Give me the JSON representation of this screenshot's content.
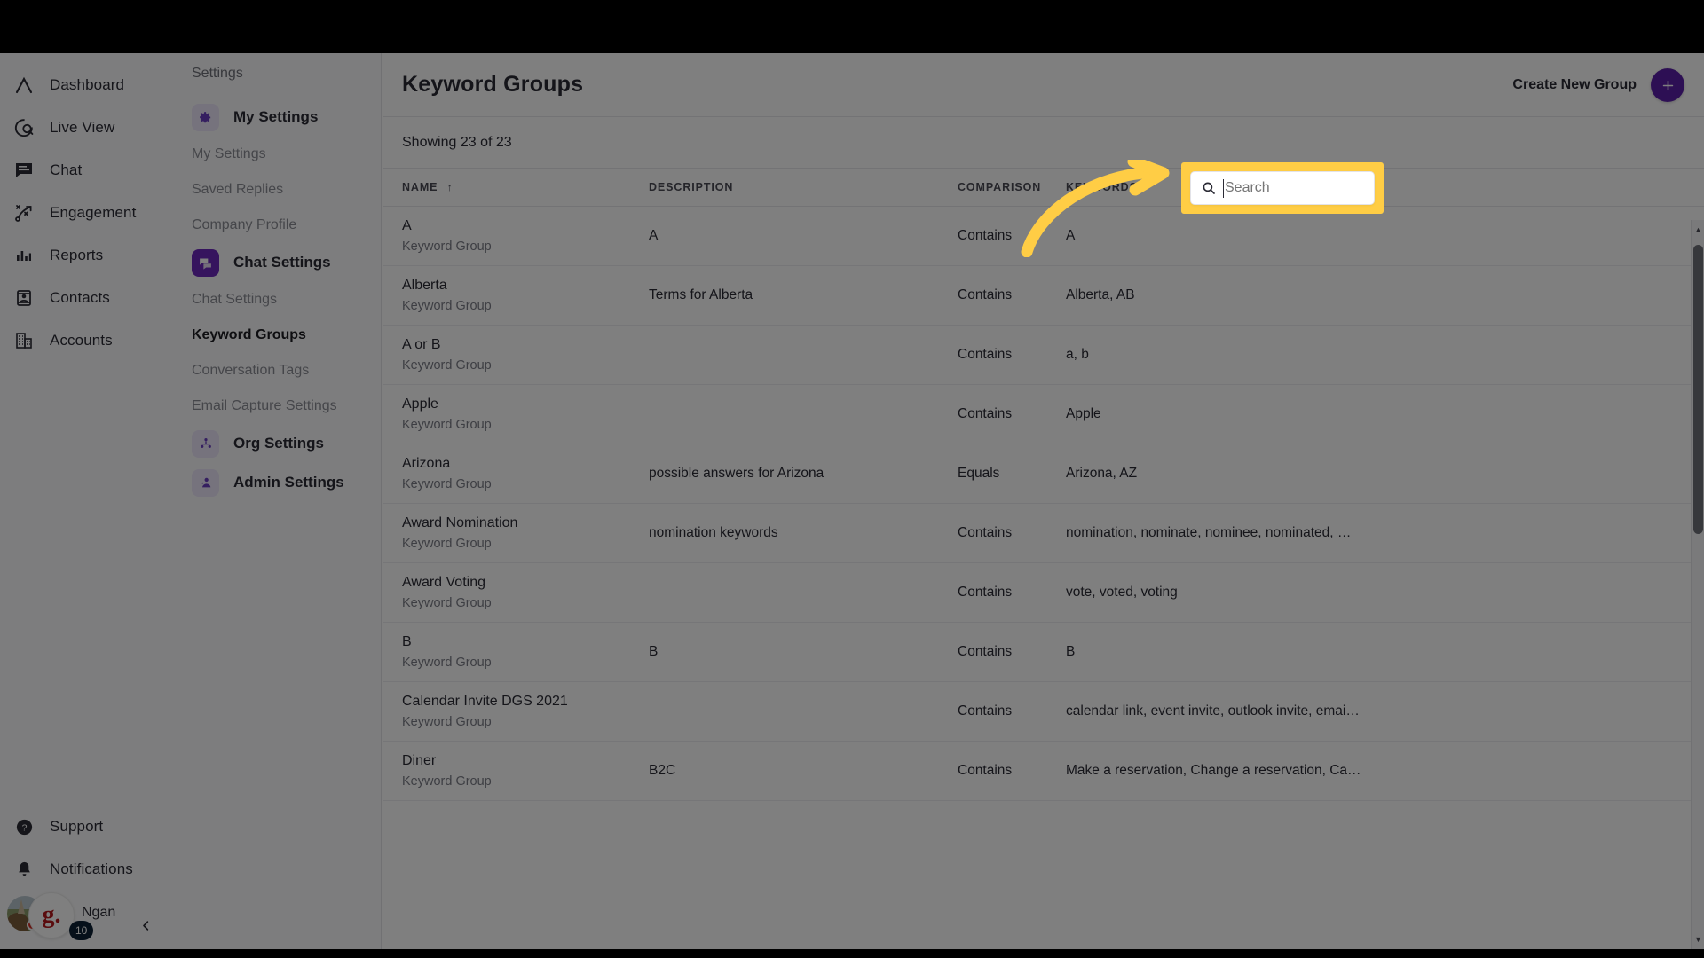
{
  "rail": {
    "items": [
      {
        "label": "Dashboard",
        "icon": "dashboard-icon"
      },
      {
        "label": "Live View",
        "icon": "live-view-icon"
      },
      {
        "label": "Chat",
        "icon": "chat-icon"
      },
      {
        "label": "Engagement",
        "icon": "engagement-icon"
      },
      {
        "label": "Reports",
        "icon": "reports-icon"
      },
      {
        "label": "Contacts",
        "icon": "contacts-icon"
      },
      {
        "label": "Accounts",
        "icon": "accounts-icon"
      }
    ],
    "bottom": [
      {
        "label": "Support",
        "icon": "help-circle-icon"
      },
      {
        "label": "Notifications",
        "icon": "bell-icon"
      }
    ],
    "profile": {
      "name": "Ngan",
      "grammarly_mark": "g.",
      "grammarly_badge": "10"
    }
  },
  "subnav": {
    "title": "Settings",
    "groups": [
      {
        "label": "My Settings",
        "icon": "gear-icon",
        "active": false,
        "children": [
          "My Settings",
          "Saved Replies",
          "Company Profile"
        ]
      },
      {
        "label": "Chat Settings",
        "icon": "chat-bubbles-icon",
        "active": true,
        "children": [
          "Chat Settings",
          "Keyword Groups",
          "Conversation Tags",
          "Email Capture Settings"
        ]
      },
      {
        "label": "Org Settings",
        "icon": "org-people-icon",
        "active": false,
        "children": []
      },
      {
        "label": "Admin Settings",
        "icon": "admin-user-icon",
        "active": false,
        "children": []
      }
    ],
    "current": "Keyword Groups"
  },
  "main": {
    "page_title": "Keyword Groups",
    "create_label": "Create New Group",
    "create_icon": "plus-icon",
    "count_label": "Showing 23 of 23",
    "columns": [
      "NAME",
      "DESCRIPTION",
      "COMPARISON",
      "KEYWORDS"
    ],
    "sort_column": "NAME",
    "sort_direction": "ascending",
    "sort_glyph": "↑",
    "row_subtitle": "Keyword Group",
    "rows": [
      {
        "name": "A",
        "description": "A",
        "comparison": "Contains",
        "keywords": "A"
      },
      {
        "name": "Alberta",
        "description": "Terms for Alberta",
        "comparison": "Contains",
        "keywords": "Alberta, AB"
      },
      {
        "name": "A or B",
        "description": "",
        "comparison": "Contains",
        "keywords": "a, b"
      },
      {
        "name": "Apple",
        "description": "",
        "comparison": "Contains",
        "keywords": "Apple"
      },
      {
        "name": "Arizona",
        "description": "possible answers for Arizona",
        "comparison": "Equals",
        "keywords": "Arizona, AZ"
      },
      {
        "name": "Award Nomination",
        "description": "nomination keywords",
        "comparison": "Contains",
        "keywords": "nomination, nominate, nominee, nominated, …"
      },
      {
        "name": "Award Voting",
        "description": "",
        "comparison": "Contains",
        "keywords": "vote, voted, voting"
      },
      {
        "name": "B",
        "description": "B",
        "comparison": "Contains",
        "keywords": "B"
      },
      {
        "name": "Calendar Invite DGS 2021",
        "description": "",
        "comparison": "Contains",
        "keywords": "calendar link, event invite, outlook invite, emai…"
      },
      {
        "name": "Diner",
        "description": "B2C",
        "comparison": "Contains",
        "keywords": "Make a reservation, Change a reservation, Ca…"
      }
    ]
  },
  "search": {
    "placeholder": "Search",
    "value": "",
    "icon": "search-icon"
  },
  "annotation": {
    "highlight_color": "#ffcd45",
    "arrow_color": "#ffcd45",
    "target": "search-input"
  },
  "colors": {
    "accent": "#5b1fa8",
    "accent_soft": "#ece6fa",
    "highlight": "#ffcd45",
    "badge": "#0d2135"
  },
  "scrollbar": {
    "up_glyph": "▲",
    "down_glyph": "▼"
  }
}
